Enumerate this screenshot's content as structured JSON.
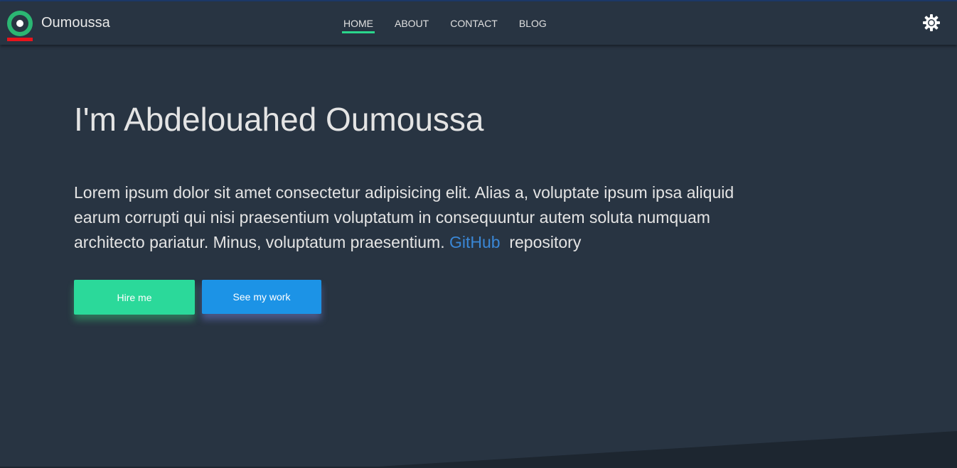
{
  "navbar": {
    "brand": "Oumoussa",
    "links": [
      {
        "label": "HOME",
        "active": true
      },
      {
        "label": "ABOUT",
        "active": false
      },
      {
        "label": "CONTACT",
        "active": false
      },
      {
        "label": "BLOG",
        "active": false
      }
    ],
    "theme_icon": "sun-gear-icon",
    "logo_icon": "ring-logo-icon"
  },
  "hero": {
    "title": "I'm Abdelouahed Oumoussa",
    "text": "Lorem ipsum dolor sit amet consectetur adipisicing elit. Alias a, voluptate ipsum ipsa aliquid earum corrupti qui nisi praesentium voluptatum in consequuntur autem soluta numquam architecto pariatur. Minus, voluptatum praesentium.",
    "link_text": "GitHub",
    "link_suffix": "repository",
    "buttons": {
      "hire": "Hire me",
      "work": "See my work"
    }
  },
  "colors": {
    "background": "#283442",
    "accent_green": "#2bd99a",
    "accent_blue": "#1c93e6",
    "link_blue": "#3a87d6",
    "logo_red": "#e8141c"
  }
}
